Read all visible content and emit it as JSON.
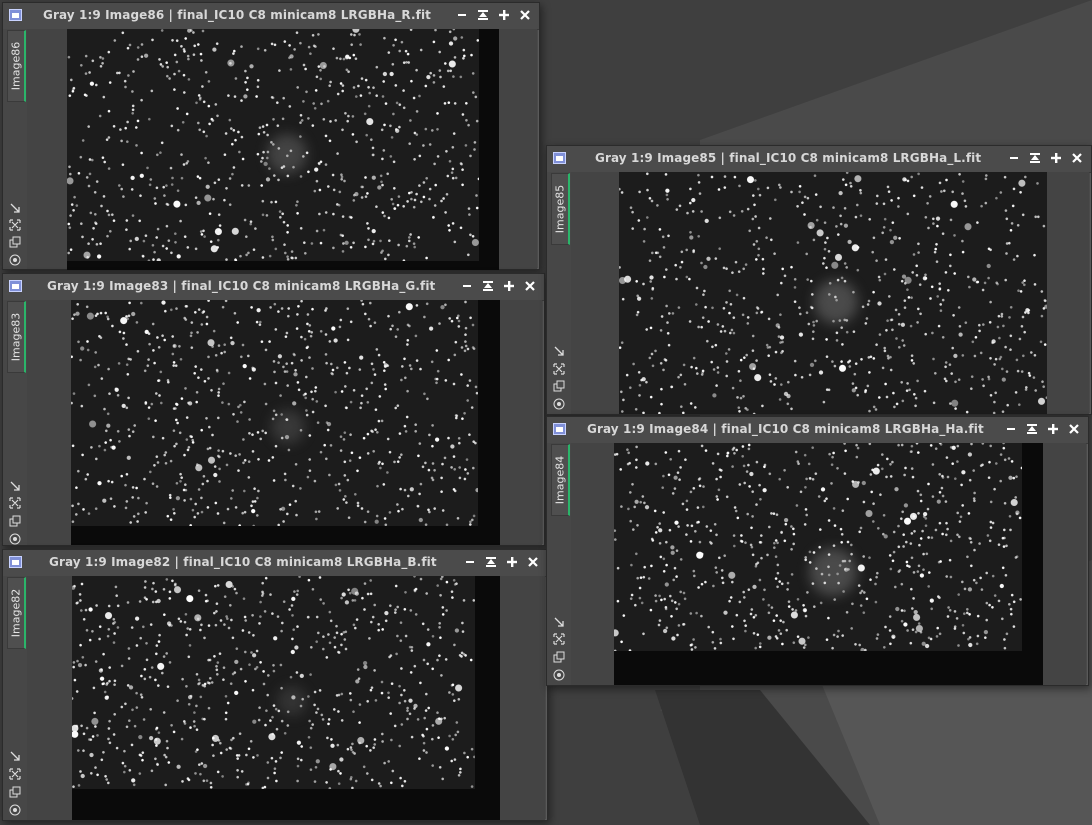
{
  "windows": [
    {
      "id": "win86",
      "title": "Gray 1:9 Image86 | final_IC10 C8 minicam8 LRGBHa_R.fit",
      "tab": "Image86"
    },
    {
      "id": "win83",
      "title": "Gray 1:9 Image83 | final_IC10 C8 minicam8 LRGBHa_G.fit",
      "tab": "Image83"
    },
    {
      "id": "win82",
      "title": "Gray 1:9 Image82 | final_IC10 C8 minicam8 LRGBHa_B.fit",
      "tab": "Image82"
    },
    {
      "id": "win85",
      "title": "Gray 1:9 Image85 | final_IC10 C8 minicam8 LRGBHa_L.fit",
      "tab": "Image85"
    },
    {
      "id": "win84",
      "title": "Gray 1:9 Image84 | final_IC10 C8 minicam8 LRGBHa_Ha.fit",
      "tab": "Image84"
    }
  ],
  "window_controls": [
    "minimize-icon",
    "shade-icon",
    "maximize-icon",
    "close-icon"
  ],
  "side_tools": [
    "zoom-to-fit-icon",
    "fit-view-icon",
    "clone-icon",
    "identify-icon"
  ],
  "colors": {
    "desktop": "#3f3f3f",
    "window": "#4a4a4a",
    "tab_accent": "#2bb56a",
    "title_text": "#d8d8d8"
  }
}
